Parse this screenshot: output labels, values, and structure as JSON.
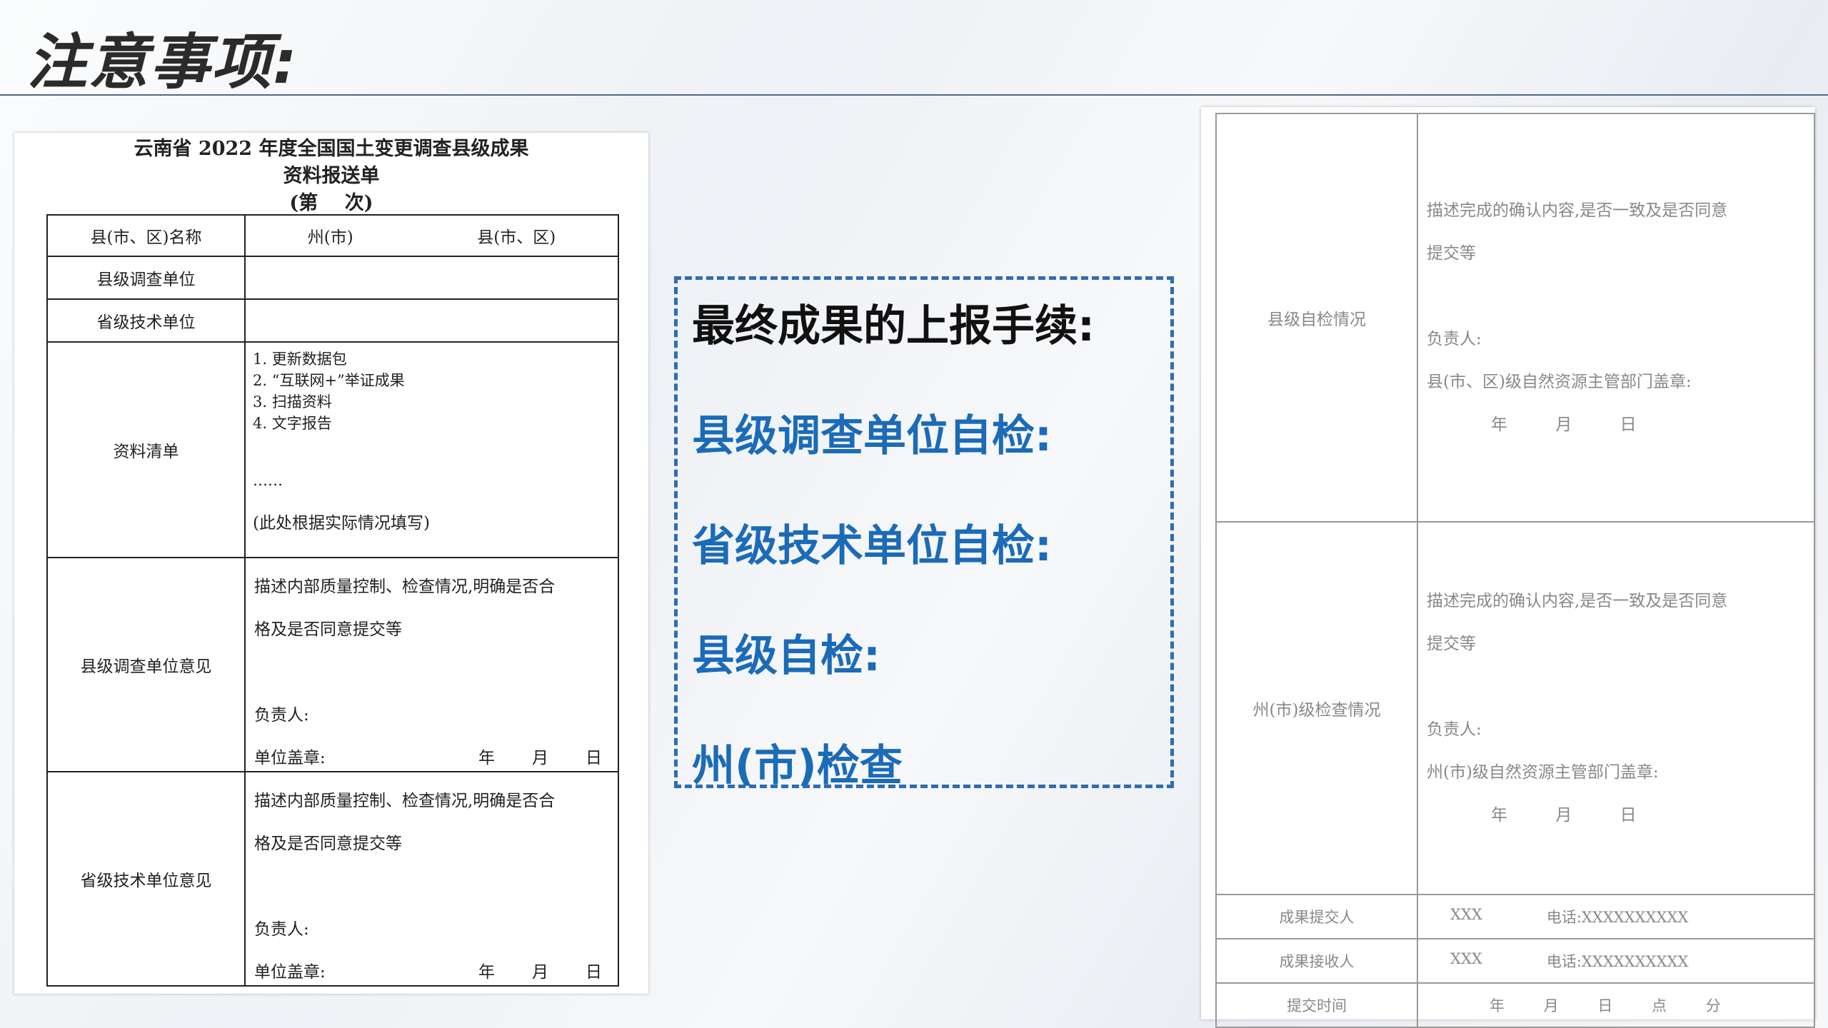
{
  "slide": {
    "title": "注意事项:"
  },
  "left_form": {
    "title_line1": "云南省 2022 年度全国国土变更调查县级成果",
    "title_line2": "资料报送单",
    "title_line3": "(第    次)",
    "rows": {
      "name_label": "县(市、区)名称",
      "name_zhou": "州(市)",
      "name_xian": "县(市、区)",
      "survey_unit_label": "县级调查单位",
      "tech_unit_label": "省级技术单位",
      "list_label": "资料清单",
      "list_items": [
        "1. 更新数据包",
        "2. “互联网+”举证成果",
        "3. 扫描资料",
        "4. 文字报告"
      ],
      "list_ellipsis": "……",
      "list_note": "(此处根据实际情况填写)",
      "survey_opinion_label": "县级调查单位意见",
      "tech_opinion_label": "省级技术单位意见",
      "opinion_desc_1": "描述内部质量控制、检查情况,明确是否合",
      "opinion_desc_2": "格及是否同意提交等",
      "responsible": "负责人:",
      "unit_seal": "单位盖章:",
      "year": "年",
      "month": "月",
      "day": "日"
    }
  },
  "center_box": {
    "items": [
      {
        "text": "最终成果的上报手续:",
        "color": "#111111"
      },
      {
        "text": "县级调查单位自检:",
        "color": "#1b6bb8"
      },
      {
        "text": "省级技术单位自检:",
        "color": "#1b6bb8"
      },
      {
        "text": "县级自检:",
        "color": "#1b6bb8"
      },
      {
        "text": "州(市)检查",
        "color": "#1b6bb8"
      }
    ]
  },
  "right_form": {
    "county_label": "县级自检情况",
    "prefecture_label": "州(市)级检查情况",
    "desc_1": "描述完成的确认内容,是否一致及是否同意",
    "desc_2": "提交等",
    "responsible": "负责人:",
    "county_seal": "县(市、区)级自然资源主管部门盖章:",
    "prefecture_seal": "州(市)级自然资源主管部门盖章:",
    "year": "年",
    "month": "月",
    "day": "日",
    "submitter_label": "成果提交人",
    "receiver_label": "成果接收人",
    "submit_time_label": "提交时间",
    "name_placeholder": "XXX",
    "phone": "电话:XXXXXXXXXX",
    "hour": "点",
    "minute": "分"
  }
}
